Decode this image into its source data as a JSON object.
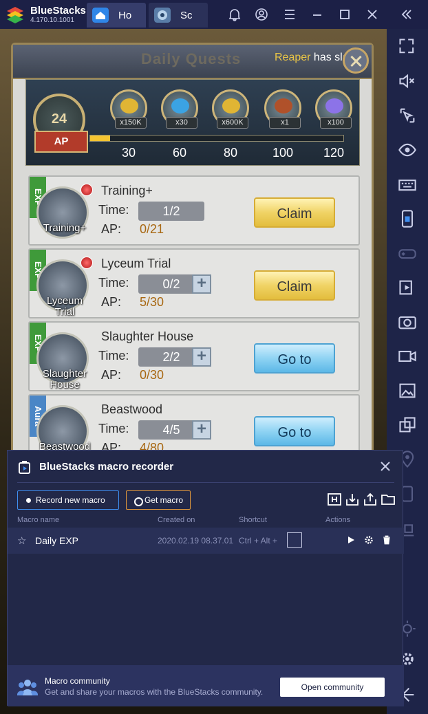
{
  "app": {
    "name": "BlueStacks",
    "version": "4.170.10.1001"
  },
  "tabs": [
    {
      "label": "Ho",
      "icon": "home-icon"
    },
    {
      "label": "Sc",
      "icon": "game-icon"
    }
  ],
  "window_controls": [
    "bell-icon",
    "account-icon",
    "menu-icon",
    "minimize-icon",
    "maximize-icon",
    "close-icon",
    "collapse-sidebar-icon"
  ],
  "sidebar": [
    "fullscreen-icon",
    "volume-mute-icon",
    "pointer-icon",
    "eye-icon",
    "keyboard-icon",
    "phone-icon",
    "gamepad-icon",
    "screen-record-icon",
    "screenshot-icon",
    "video-icon",
    "gallery-icon",
    "multi-instance-icon",
    "location-icon",
    "rotate-icon",
    "install-apk-icon",
    "brightness-icon",
    "settings-icon",
    "back-icon"
  ],
  "game": {
    "title": "Daily Quests",
    "ticker": {
      "name": "Reaper",
      "text": " has slain"
    },
    "ap": {
      "value": "24",
      "label": "AP",
      "progress_fraction": 0.08
    },
    "rewards": [
      {
        "count": "x150K",
        "icon": "gold-coins-icon",
        "color": "#e0b534"
      },
      {
        "count": "x30",
        "icon": "blue-crystal-icon",
        "color": "#3ba3e3"
      },
      {
        "count": "x600K",
        "icon": "gold-coins-icon",
        "color": "#e0b534"
      },
      {
        "count": "x1",
        "icon": "treasure-chest-icon",
        "color": "#b0512a"
      },
      {
        "count": "x100",
        "icon": "diamond-icon",
        "color": "#8c73e8"
      }
    ],
    "thresholds": [
      "30",
      "60",
      "80",
      "100",
      "120"
    ],
    "time_label": "Time:",
    "ap_label": "AP:",
    "quests": [
      {
        "tag": "EXP",
        "tag_color": "#3f9a3a",
        "title": "Training+",
        "icon_label": "Training+",
        "time": "1/2",
        "ap": "0/21",
        "button": "Claim",
        "button_type": "claim",
        "has_plus": false,
        "has_dot": true
      },
      {
        "tag": "EXP",
        "tag_color": "#3f9a3a",
        "title": "Lyceum Trial",
        "icon_label": "Lyceum Trial",
        "time": "0/2",
        "ap": "5/30",
        "button": "Claim",
        "button_type": "claim",
        "has_plus": true,
        "has_dot": true
      },
      {
        "tag": "EXP",
        "tag_color": "#3f9a3a",
        "title": "Slaughter House",
        "icon_label": "Slaughter House",
        "time": "2/2",
        "ap": "0/30",
        "button": "Go to",
        "button_type": "goto",
        "has_plus": true,
        "has_dot": false
      },
      {
        "tag": "Aura",
        "tag_color": "#4a86c6",
        "title": "Beastwood",
        "icon_label": "Beastwood",
        "time": "4/5",
        "ap": "4/80",
        "button": "Go to",
        "button_type": "goto",
        "has_plus": true,
        "has_dot": false
      }
    ]
  },
  "macro": {
    "title": "BlueStacks macro recorder",
    "record_label": "Record new macro",
    "get_label": "Get macro",
    "tools": [
      "merge-macro-icon",
      "import-icon",
      "export-icon",
      "folder-icon"
    ],
    "columns": {
      "name": "Macro name",
      "created": "Created on",
      "shortcut": "Shortcut",
      "actions": "Actions"
    },
    "rows": [
      {
        "name": "Daily EXP",
        "created": "2020.02.19 08.37.01",
        "shortcut": "Ctrl + Alt +"
      }
    ],
    "community_title": "Macro community",
    "community_sub": "Get and share your macros with the BlueStacks community.",
    "community_button": "Open community"
  }
}
